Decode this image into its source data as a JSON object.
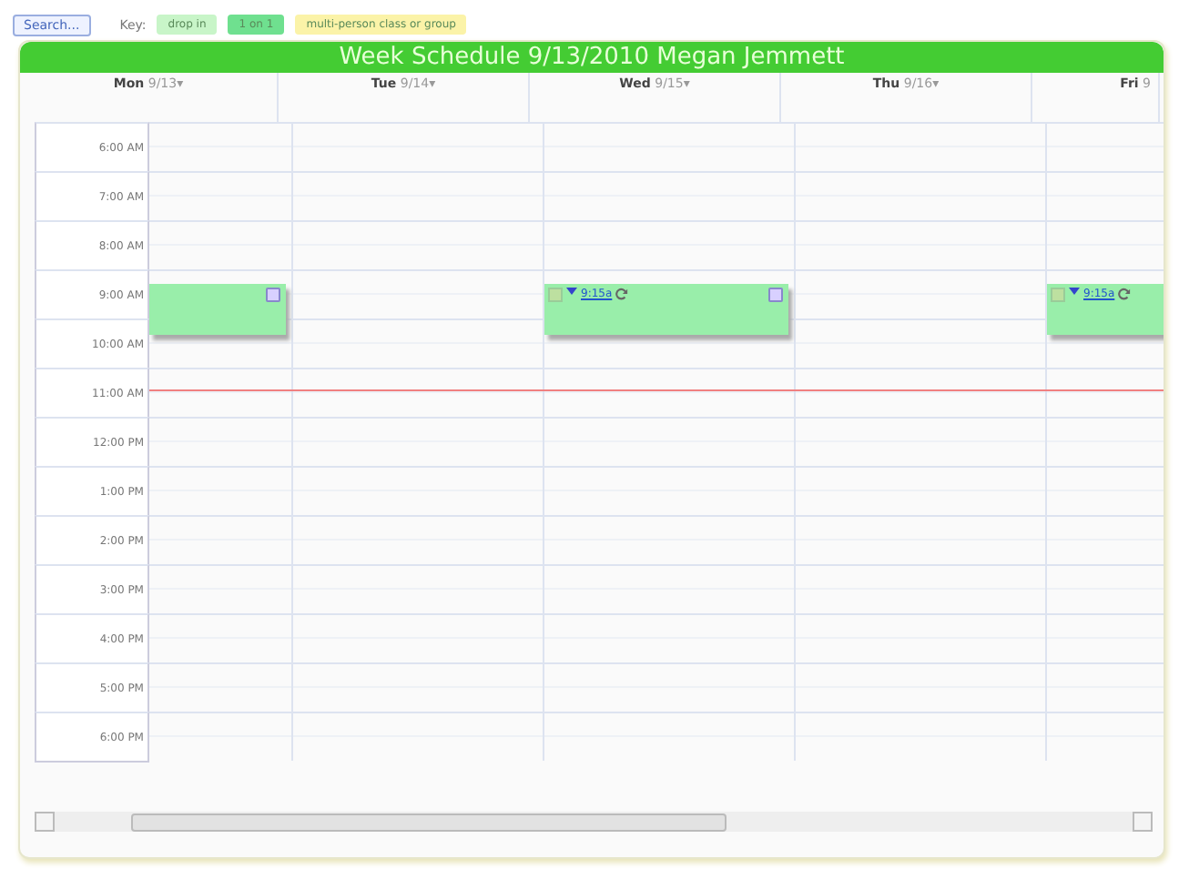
{
  "toolbar": {
    "search_button": "Search...",
    "key_label": "Key:",
    "legend": [
      {
        "label": "drop in",
        "color": "#c8f5c8"
      },
      {
        "label": "1 on 1",
        "color": "#6fe08f"
      },
      {
        "label": "multi-person class or group",
        "color": "#fbf3a8"
      }
    ]
  },
  "schedule": {
    "title": "Week Schedule 9/13/2010 Megan Jemmett",
    "days": [
      {
        "name": "Mon",
        "date": "9/13▾"
      },
      {
        "name": "Tue",
        "date": "9/14▾"
      },
      {
        "name": "Wed",
        "date": "9/15▾"
      },
      {
        "name": "Thu",
        "date": "9/16▾"
      },
      {
        "name": "Fri",
        "date": "9"
      }
    ],
    "hours": [
      {
        "label": "6:00 AM"
      },
      {
        "label": "7:00 AM"
      },
      {
        "label": "8:00 AM"
      },
      {
        "label": "9:00 AM",
        "cells": [
          {
            "booked": true,
            "menu": true
          },
          null,
          {
            "booked": true,
            "checkbox": true,
            "link": "9:15a",
            "menu": true
          },
          null,
          {
            "booked": true,
            "checkbox": true,
            "link": "9:15a",
            "menu": false
          }
        ]
      },
      {
        "label": "10:00 AM"
      },
      {
        "label": "11:00 AM",
        "now": true
      },
      {
        "label": "12:00 PM"
      },
      {
        "label": "1:00 PM"
      },
      {
        "label": "2:00 PM"
      },
      {
        "label": "3:00 PM"
      },
      {
        "label": "4:00 PM"
      },
      {
        "label": "5:00 PM"
      },
      {
        "label": "6:00 PM"
      }
    ]
  }
}
